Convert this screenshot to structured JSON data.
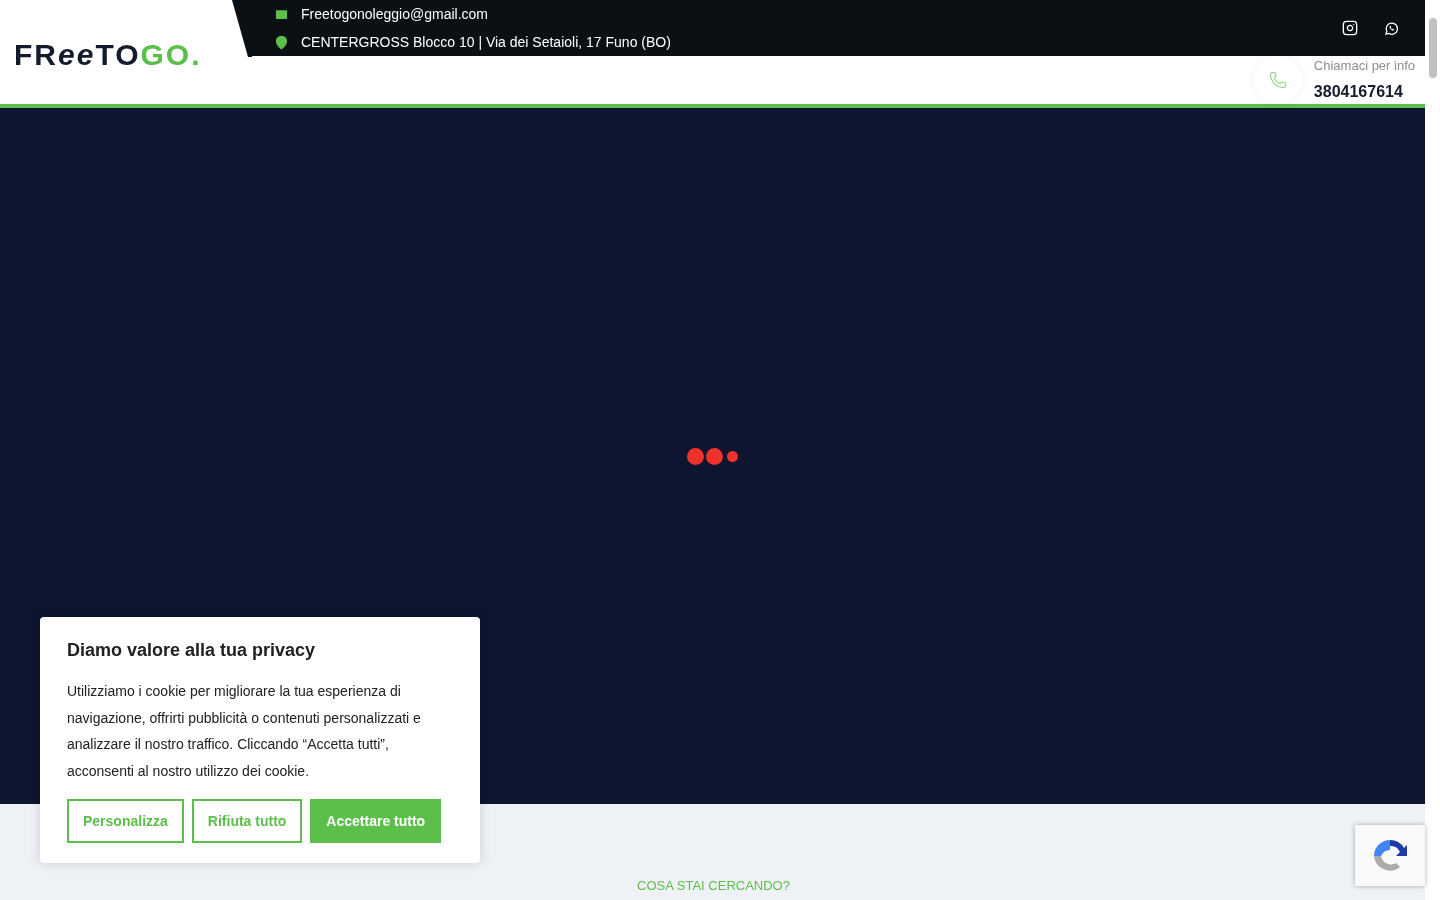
{
  "header": {
    "logo": [
      {
        "text": "FR",
        "kind": "plain"
      },
      {
        "text": "ee",
        "kind": "tire"
      },
      {
        "text": "TO",
        "kind": "plain"
      },
      {
        "text": "GO",
        "kind": "green"
      },
      {
        "text": ".",
        "kind": "green"
      }
    ],
    "email": "Freetogonoleggio@gmail.com",
    "address": "CENTERGROSS Blocco 10 | Via dei Setaioli, 17 Funo (BO)",
    "call_label": "Chiamaci per info",
    "phone": "3804167614"
  },
  "section": {
    "eyebrow": "COSA STAI CERCANDO?"
  },
  "cookie_banner": {
    "title": "Diamo valore alla tua privacy",
    "text": "Utilizziamo i cookie per migliorare la tua esperienza di navigazione, offrirti pubblicità o contenuti personalizzati e analizzare il nostro traffico. Cliccando “Accetta tutti”, acconsenti al nostro utilizzo dei cookie.",
    "buttons": [
      {
        "label": "Personalizza",
        "kind": "outline"
      },
      {
        "label": "Rifiuta tutto",
        "kind": "outline"
      },
      {
        "label": "Accettare tutto",
        "kind": "solid"
      }
    ]
  }
}
